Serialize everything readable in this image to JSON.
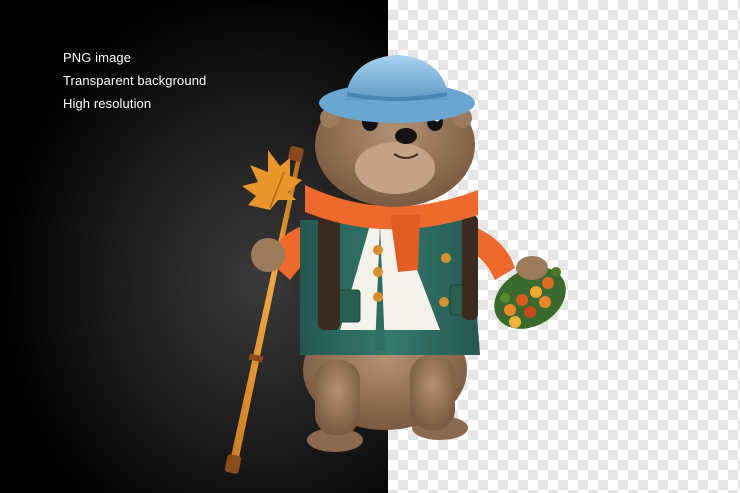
{
  "features": [
    "PNG image",
    "Transparent background",
    "High resolution"
  ],
  "icons": {
    "figure": "groundhog-figurine-icon"
  },
  "colors": {
    "dark_background": "#000000",
    "checker_light": "#ffffff",
    "checker_dark": "#e6e6e6",
    "text": "#ffffff",
    "hat": "#7fb7e0",
    "scarf": "#ee6a2c",
    "vest": "#2e6e62"
  }
}
